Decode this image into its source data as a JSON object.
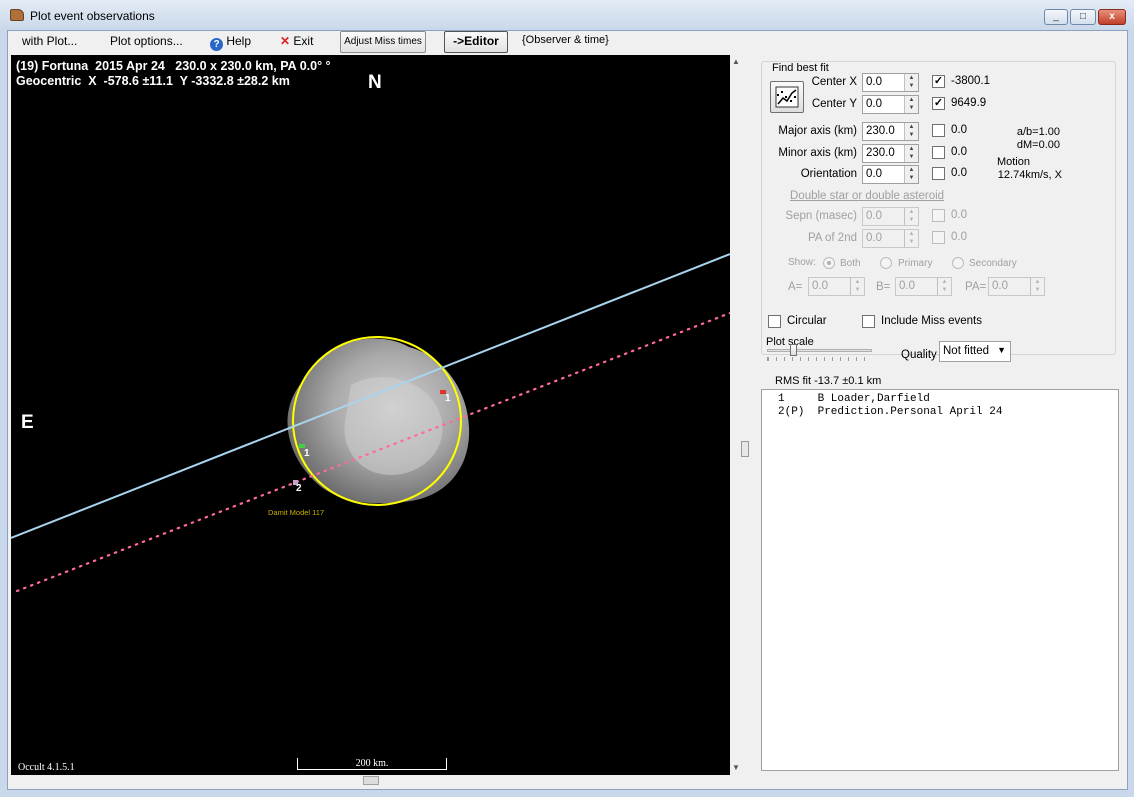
{
  "window": {
    "title": "Plot event observations",
    "minimize": "_",
    "maximize": "□",
    "close": "x"
  },
  "menu": {
    "with_plot": "with Plot...",
    "plot_options": "Plot options...",
    "help": "Help",
    "exit": "Exit",
    "adjust_miss": "Adjust Miss times",
    "editor": "->Editor",
    "observer_time": "{Observer & time}"
  },
  "plot": {
    "header_line1": "(19) Fortuna  2015 Apr 24   230.0 x 230.0 km, PA 0.0° °",
    "header_line2": "Geocentric  X  -578.6 ±11.1  Y -3332.8 ±28.2 km",
    "north": "N",
    "east": "E",
    "model_label": "Damit Model 117",
    "chord_labels": [
      "1",
      "1",
      "2"
    ],
    "scale_label": "200 km.",
    "version": "Occult 4.1.5.1",
    "colors": {
      "background": "#000000",
      "fit_ellipse": "#ffff00",
      "chord_observed": "#a9d4ee",
      "chord_prediction": "#ff6a9c",
      "asteroid": "#b8b8b8"
    }
  },
  "panel": {
    "find_best_fit": "Find best fit",
    "center_x_label": "Center X",
    "center_x": "0.0",
    "center_x_fixed": true,
    "center_x_result": "-3800.1",
    "center_y_label": "Center Y",
    "center_y": "0.0",
    "center_y_fixed": true,
    "center_y_result": "9649.9",
    "major_label": "Major axis (km)",
    "major": "230.0",
    "major_result": "0.0",
    "minor_label": "Minor axis (km)",
    "minor": "230.0",
    "minor_result": "0.0",
    "orientation_label": "Orientation",
    "orientation": "0.0",
    "orientation_result": "0.0",
    "ab_ratio": "a/b=1.00",
    "dm": "dM=0.00",
    "motion_label": "Motion",
    "motion": "12.74km/s, X",
    "double_star": "Double star  or  double asteroid",
    "sepn_label": "Sepn (masec)",
    "sepn": "0.0",
    "sepn_result": "0.0",
    "pa2_label": "PA of 2nd",
    "pa2": "0.0",
    "pa2_result": "0.0",
    "show_label": "Show:",
    "show_both": "Both",
    "show_primary": "Primary",
    "show_secondary": "Secondary",
    "a_label": "A=",
    "a_value": "0.0",
    "b_label": "B=",
    "b_value": "0.0",
    "pa_label": "PA=",
    "pa_value": "0.0",
    "circular": "Circular",
    "include_miss": "Include Miss events",
    "plot_scale": "Plot scale",
    "quality_label": "Quality",
    "quality": "Not fitted",
    "rms_fit": "RMS fit -13.7 ±0.1 km",
    "observations": [
      "1     B Loader,Darfield",
      "2(P)  Prediction.Personal April 24"
    ]
  }
}
